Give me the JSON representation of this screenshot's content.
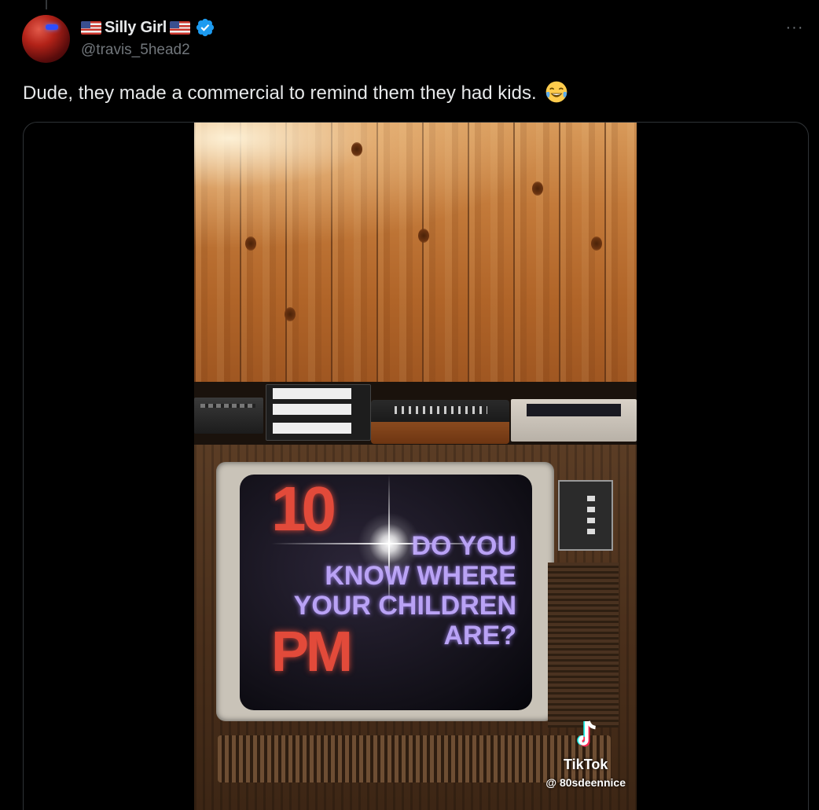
{
  "post": {
    "author": {
      "display_name": "Silly Girl",
      "handle": "@travis_5head2",
      "verified": true,
      "flag_emoji": "us-flag-icon",
      "avatar_icon": "avatar"
    },
    "more_label": "···",
    "text": "Dude, they made a commercial to remind them they had kids.",
    "emoji": "face-with-tears-of-joy-icon"
  },
  "video": {
    "screen": {
      "time_number": "10",
      "time_unit": "PM",
      "question_lines": [
        "DO YOU",
        "KNOW WHERE",
        "YOUR CHILDREN",
        "ARE?"
      ]
    },
    "watermark": {
      "brand": "TikTok",
      "username": "@ 80sdeennice"
    }
  },
  "colors": {
    "background": "#000000",
    "text_primary": "#e7e9ea",
    "text_secondary": "#71767b",
    "verified_blue": "#1d9bf0",
    "border": "#2f3336"
  }
}
